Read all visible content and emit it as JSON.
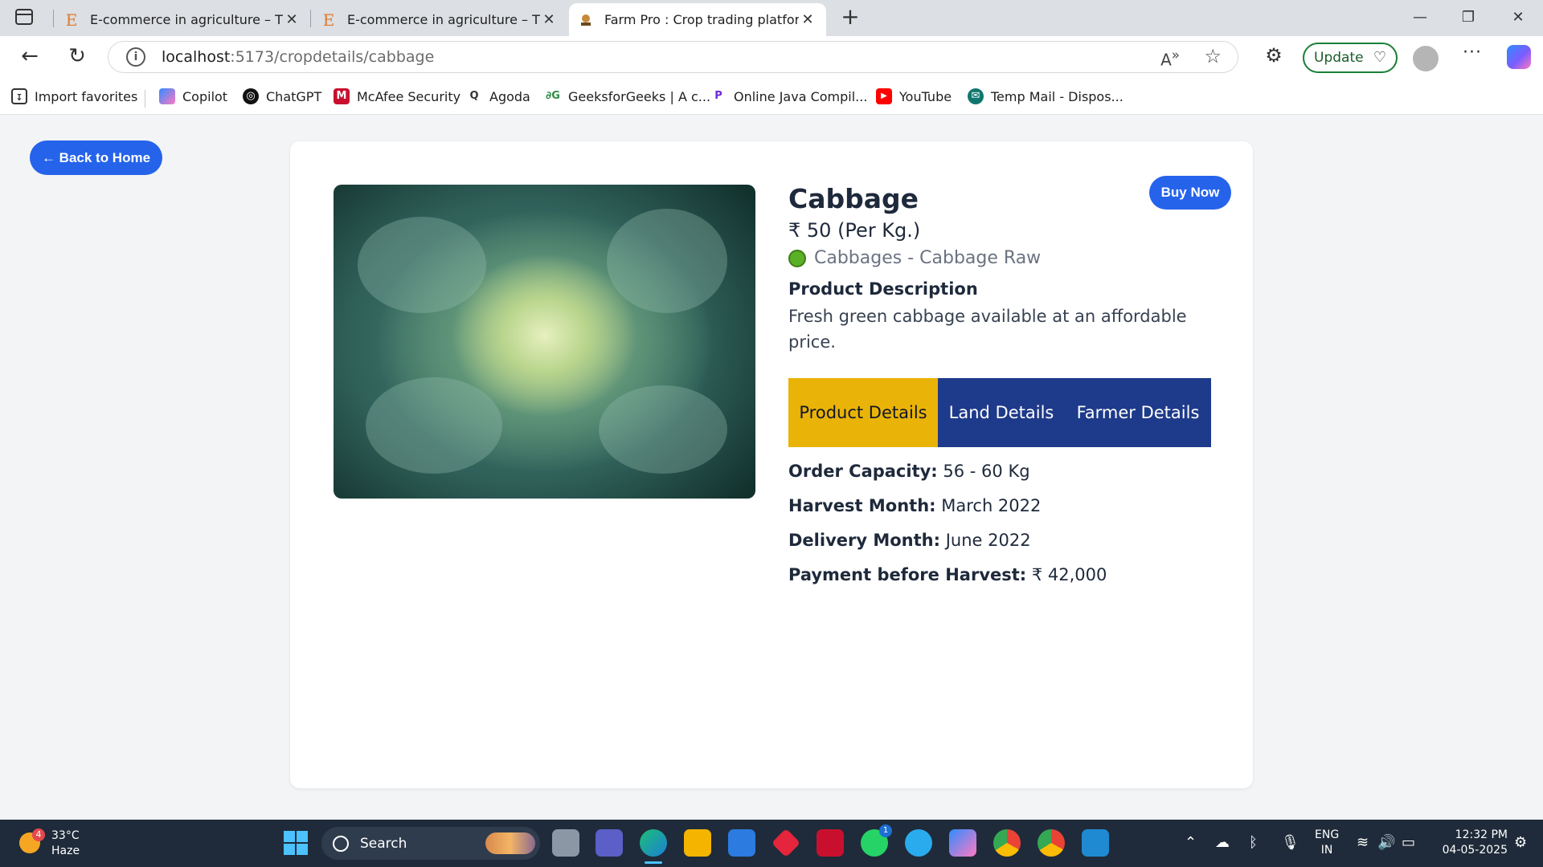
{
  "browser": {
    "tabs": [
      {
        "title": "E-commerce in agriculture – The c",
        "favicon": "E"
      },
      {
        "title": "E-commerce in agriculture – The c",
        "favicon": "E"
      },
      {
        "title": "Farm Pro : Crop trading platform",
        "favicon": "farm-icon"
      }
    ],
    "url_host": "localhost",
    "url_path": ":5173/cropdetails/cabbage",
    "update_label": "Update",
    "favorites": [
      {
        "label": "Import favorites"
      },
      {
        "label": "Copilot"
      },
      {
        "label": "ChatGPT"
      },
      {
        "label": "McAfee Security"
      },
      {
        "label": "Agoda"
      },
      {
        "label": "GeeksforGeeks | A c..."
      },
      {
        "label": "Online Java Compil..."
      },
      {
        "label": "YouTube"
      },
      {
        "label": "Temp Mail - Dispos..."
      }
    ]
  },
  "page": {
    "back_label": "← Back to Home",
    "buy_label": "Buy Now",
    "crop": {
      "name": "Cabbage",
      "price": "₹ 50 (Per Kg.)",
      "variety": "Cabbages - Cabbage Raw",
      "description_heading": "Product Description",
      "description": "Fresh green cabbage available at an affordable price."
    },
    "detail_tabs": [
      {
        "label": "Product Details",
        "active": true
      },
      {
        "label": "Land Details",
        "active": false
      },
      {
        "label": "Farmer Details",
        "active": false
      }
    ],
    "details": [
      {
        "key": "Order Capacity:",
        "value": "56 - 60 Kg"
      },
      {
        "key": "Harvest Month:",
        "value": "March 2022"
      },
      {
        "key": "Delivery Month:",
        "value": "June 2022"
      },
      {
        "key": "Payment before Harvest:",
        "value": "₹ 42,000"
      }
    ],
    "colors": {
      "primary": "#2563eb",
      "tab_active": "#eab308",
      "tab_inactive": "#1e3a8a"
    }
  },
  "taskbar": {
    "weather_temp": "33°C",
    "weather_cond": "Haze",
    "weather_badge": "4",
    "search_label": "Search",
    "whatsapp_badge": "1",
    "lang_top": "ENG",
    "lang_bottom": "IN",
    "time": "12:32 PM",
    "date": "04-05-2025"
  }
}
